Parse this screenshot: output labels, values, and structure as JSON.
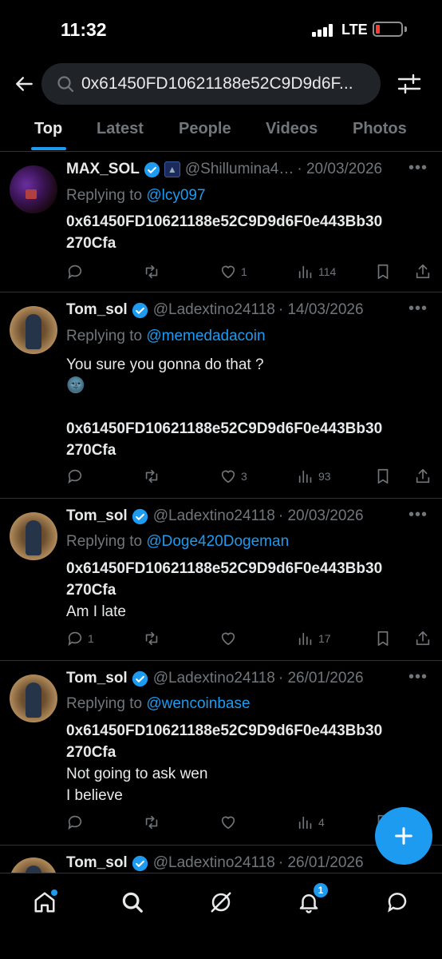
{
  "status": {
    "time": "11:32",
    "network": "LTE"
  },
  "search": {
    "query": "0x61450FD10621188e52C9D9d6F..."
  },
  "tabs": [
    {
      "label": "Top",
      "active": true
    },
    {
      "label": "Latest",
      "active": false
    },
    {
      "label": "People",
      "active": false
    },
    {
      "label": "Videos",
      "active": false
    },
    {
      "label": "Photos",
      "active": false
    }
  ],
  "posts": [
    {
      "name": "MAX_SOL",
      "handle": "@Shillumina4…",
      "date": "· 20/03/2026",
      "replying_prefix": "Replying to",
      "replying_to": "@lcy097",
      "lines": [
        {
          "text": "0x61450FD10621188e52C9D9d6F0e443Bb30",
          "bold": true
        },
        {
          "text": "270Cfa",
          "bold": true
        }
      ],
      "replies": "",
      "reposts": "",
      "likes": "1",
      "views": "114"
    },
    {
      "name": "Tom_sol",
      "handle": "@Ladextino24118",
      "date": "· 14/03/2026",
      "replying_prefix": "Replying to",
      "replying_to": "@memedadacoin",
      "lines": [
        {
          "text": "You sure you gonna do that ?",
          "bold": false
        },
        {
          "text": "🌚",
          "bold": false
        },
        {
          "text": "",
          "bold": false
        },
        {
          "text": "0x61450FD10621188e52C9D9d6F0e443Bb30",
          "bold": true
        },
        {
          "text": "270Cfa",
          "bold": true
        }
      ],
      "replies": "",
      "reposts": "",
      "likes": "3",
      "views": "93"
    },
    {
      "name": "Tom_sol",
      "handle": "@Ladextino24118",
      "date": "· 20/03/2026",
      "replying_prefix": "Replying to",
      "replying_to": "@Doge420Dogeman",
      "lines": [
        {
          "text": "0x61450FD10621188e52C9D9d6F0e443Bb30",
          "bold": true
        },
        {
          "text": "270Cfa",
          "bold": true
        },
        {
          "text": "Am I late",
          "bold": false
        }
      ],
      "replies": "1",
      "reposts": "",
      "likes": "",
      "views": "17"
    },
    {
      "name": "Tom_sol",
      "handle": "@Ladextino24118",
      "date": "· 26/01/2026",
      "replying_prefix": "Replying to",
      "replying_to": "@wencoinbase",
      "lines": [
        {
          "text": "0x61450FD10621188e52C9D9d6F0e443Bb30",
          "bold": true
        },
        {
          "text": "270Cfa",
          "bold": true
        },
        {
          "text": "Not going to ask wen",
          "bold": false
        },
        {
          "text": "I believe",
          "bold": false
        }
      ],
      "replies": "",
      "reposts": "",
      "likes": "",
      "views": "4"
    },
    {
      "name": "Tom_sol",
      "handle": "@Ladextino24118",
      "date": "· 26/01/2026"
    }
  ],
  "nav": {
    "notifications_badge": "1"
  },
  "colors": {
    "accent": "#1d9bf0",
    "background": "#000000",
    "muted": "#71767b",
    "text": "#e7e9ea"
  }
}
